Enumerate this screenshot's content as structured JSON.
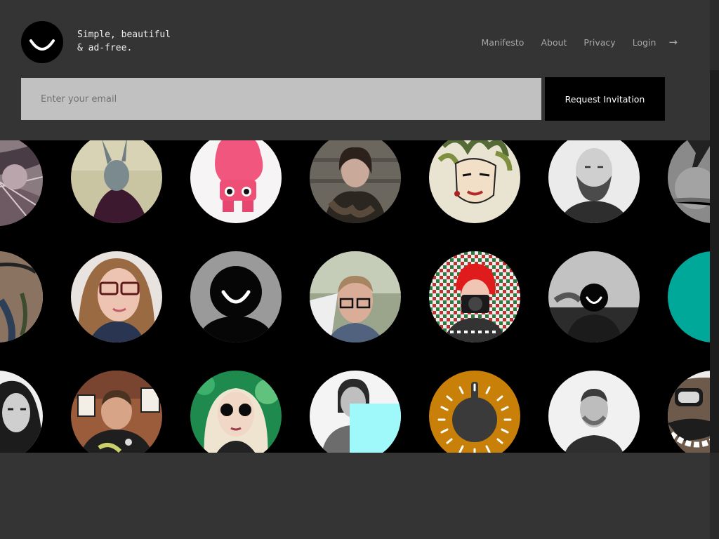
{
  "brand": {
    "logo_icon": "smile-logo-icon",
    "tagline_line1": "Simple, beautiful",
    "tagline_line2": "& ad-free."
  },
  "nav": {
    "items": [
      "Manifesto",
      "About",
      "Privacy",
      "Login"
    ],
    "arrow": "→"
  },
  "signup": {
    "email_placeholder": "Enter your email",
    "email_value": "",
    "button_label": "Request Invitation"
  },
  "avatars": [
    [
      "engraving-artwork",
      "rabbit-mask-portrait",
      "pink-toy-figure",
      "woman-with-fur-coat",
      "medusa-illustration",
      "bearded-man-portrait",
      "abstract-bw-photo"
    ],
    [
      "tattooed-man",
      "woman-with-glasses",
      "default-smile-avatar",
      "man-with-glasses",
      "red-hair-photographer",
      "default-smile-avatar-2",
      "teal-graphic"
    ],
    [
      "long-haired-woman",
      "man-drawing",
      "woman-in-sunglasses",
      "man-with-cyan-square",
      "skillet-logo",
      "man-portrait",
      "cartoon-face"
    ]
  ],
  "colors": {
    "background": "#343434",
    "grid_background": "#000000",
    "button": "#000000",
    "input": "#c1c1c1",
    "skillet_orange": "#c98009",
    "teal": "#00a89a",
    "cyan": "#9ff9fb"
  }
}
